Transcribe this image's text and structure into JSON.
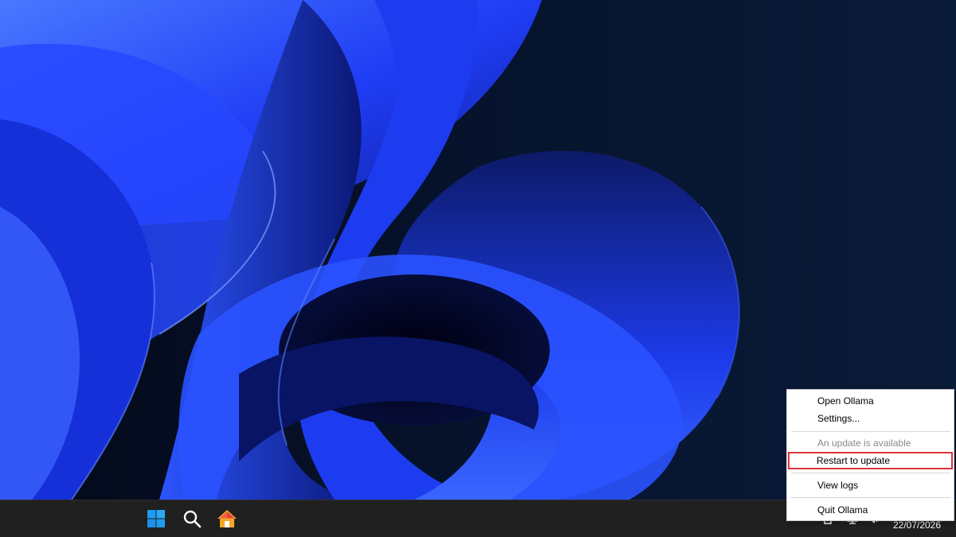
{
  "desktop": {
    "wallpaper": "windows-11-bloom-wallpaper"
  },
  "taskbar": {
    "start_icon": "windows-start-icon",
    "search_icon": "search-icon",
    "home_icon": "home-icon",
    "tray": {
      "date": "22/07/2026"
    }
  },
  "context_menu": {
    "items": [
      {
        "label": "Open Ollama",
        "enabled": true
      },
      {
        "label": "Settings...",
        "enabled": true
      },
      {
        "label": "An update is available",
        "enabled": false
      },
      {
        "label": "Restart to update",
        "enabled": true,
        "highlighted": true
      },
      {
        "label": "View logs",
        "enabled": true
      },
      {
        "label": "Quit Ollama",
        "enabled": true
      }
    ]
  },
  "colors": {
    "taskbar": "#202020",
    "menu_bg": "#ffffff",
    "highlight_border": "#d9343c",
    "start_blue": "#1e9cf0",
    "home_orange": "#f5a623",
    "wallpaper_blue": "#1a3cff"
  }
}
